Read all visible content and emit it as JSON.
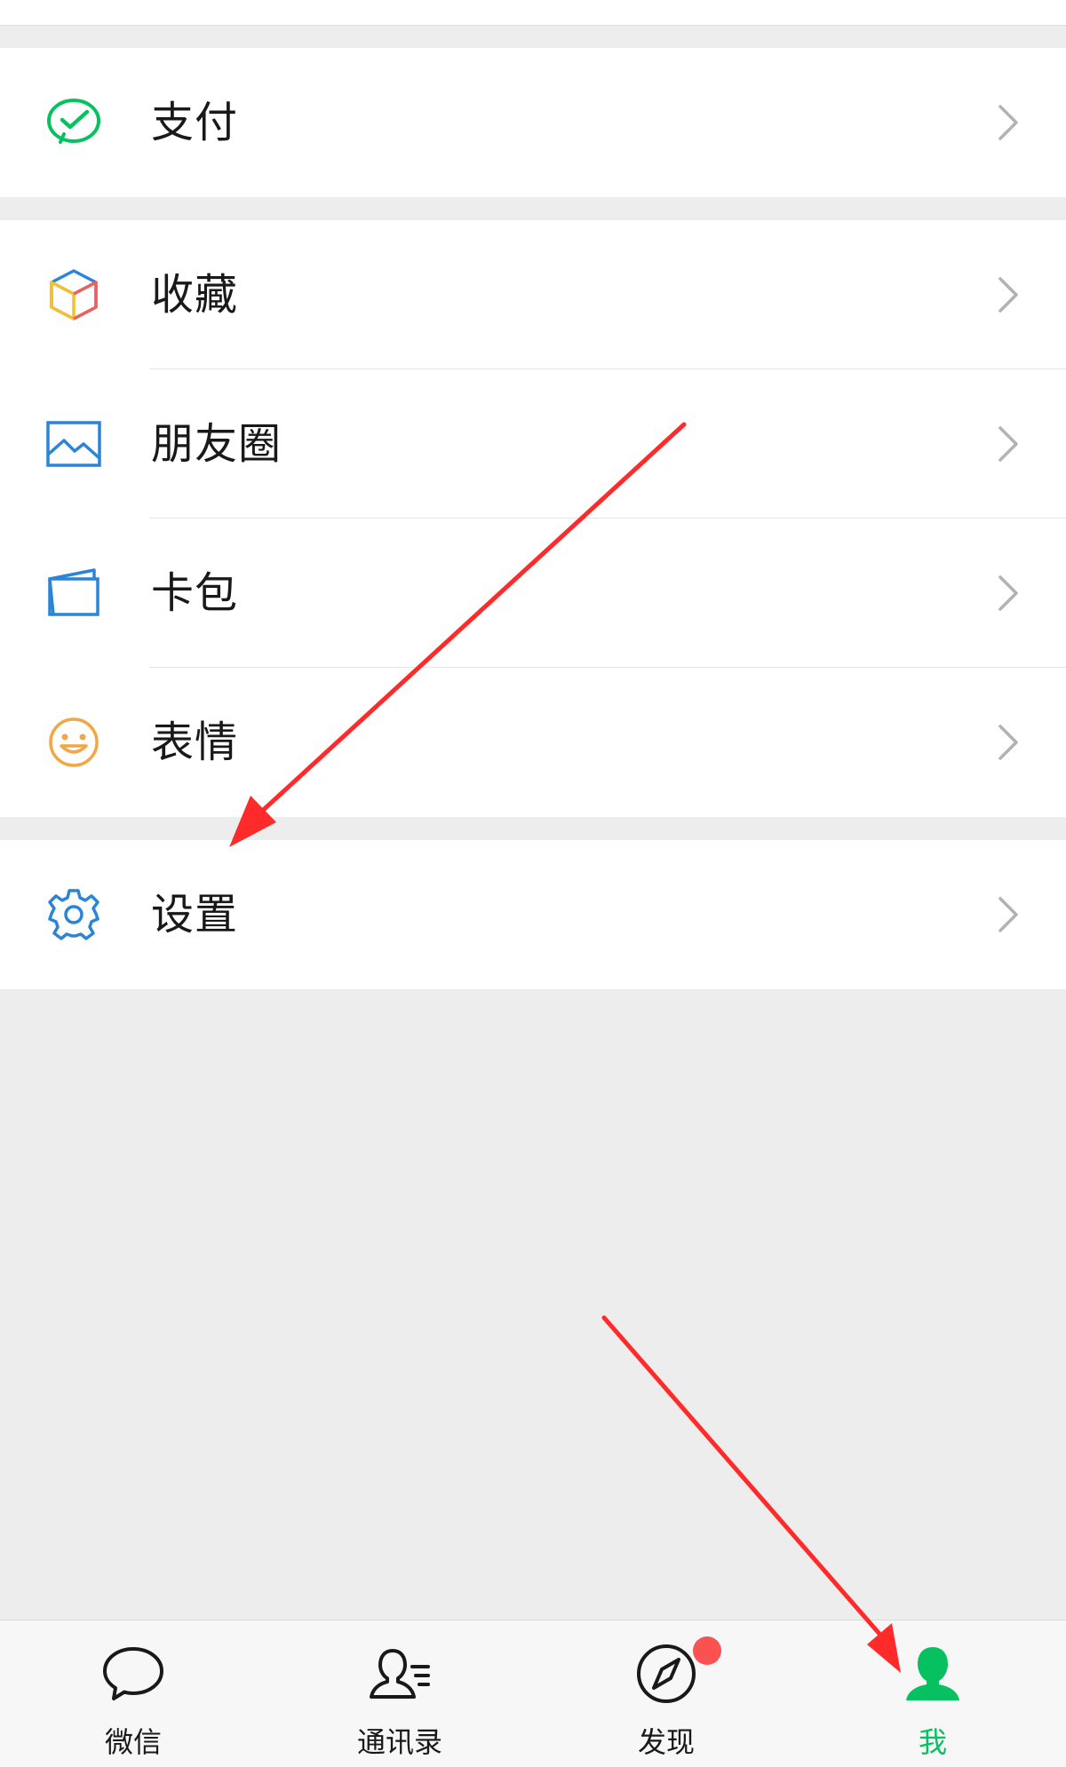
{
  "menu": {
    "pay": {
      "label": "支付",
      "icon": "pay-icon"
    },
    "favorites": {
      "label": "收藏",
      "icon": "cube-icon"
    },
    "moments": {
      "label": "朋友圈",
      "icon": "picture-icon"
    },
    "cards": {
      "label": "卡包",
      "icon": "card-wallet-icon"
    },
    "stickers": {
      "label": "表情",
      "icon": "smiley-icon"
    },
    "settings": {
      "label": "设置",
      "icon": "gear-icon"
    }
  },
  "tabs": [
    {
      "label": "微信",
      "icon": "chat-bubble-icon",
      "active": false
    },
    {
      "label": "通讯录",
      "icon": "contacts-icon",
      "active": false
    },
    {
      "label": "发现",
      "icon": "compass-icon",
      "active": false,
      "badge": true
    },
    {
      "label": "我",
      "icon": "person-icon",
      "active": true
    }
  ],
  "colors": {
    "brand_green": "#07c160",
    "icon_blue": "#2b84d6",
    "smiley_orange": "#f2a645",
    "badge_red": "#fa5151",
    "arrow_red": "#ff2a2a",
    "background": "#ededed"
  }
}
